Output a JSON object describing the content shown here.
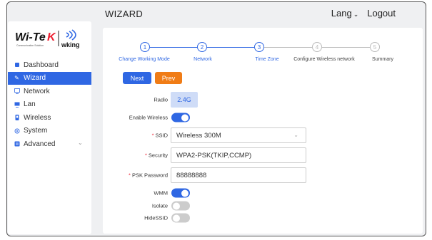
{
  "header": {
    "title": "WIZARD",
    "lang": "Lang",
    "logout": "Logout"
  },
  "brand": {
    "logo_text": "Wi-Tek",
    "logo_sub": "Communication Solution",
    "logo2": "wking"
  },
  "sidebar": {
    "items": [
      {
        "label": "Dashboard",
        "icon": "dashboard-icon"
      },
      {
        "label": "Wizard",
        "icon": "wizard-icon"
      },
      {
        "label": "Network",
        "icon": "monitor-icon"
      },
      {
        "label": "Lan",
        "icon": "lan-icon"
      },
      {
        "label": "Wireless",
        "icon": "wireless-icon"
      },
      {
        "label": "System",
        "icon": "system-icon"
      },
      {
        "label": "Advanced",
        "icon": "advanced-icon"
      }
    ]
  },
  "stepper": {
    "steps": [
      {
        "num": "1",
        "label": "Change Working Mode"
      },
      {
        "num": "2",
        "label": "Network"
      },
      {
        "num": "3",
        "label": "Time Zone"
      },
      {
        "num": "4",
        "label": "Configure Wireless network"
      },
      {
        "num": "5",
        "label": "Summary"
      }
    ]
  },
  "buttons": {
    "next": "Next",
    "prev": "Prev"
  },
  "form": {
    "radio_label": "Radio",
    "radio_value": "2.4G",
    "enable_wireless_label": "Enable Wireless",
    "enable_wireless": true,
    "ssid_label": "SSID",
    "ssid_value": "Wireless 300M",
    "security_label": "Security",
    "security_value": "WPA2-PSK(TKIP,CCMP)",
    "psk_label": "PSK Password",
    "psk_value": "88888888",
    "wmm_label": "WMM",
    "wmm": true,
    "isolate_label": "Isolate",
    "isolate": false,
    "hidessid_label": "HideSSID",
    "hidessid": false
  },
  "colors": {
    "accent": "#2f67e3",
    "prev": "#f07c16",
    "badge_bg": "#cfdcf7"
  }
}
